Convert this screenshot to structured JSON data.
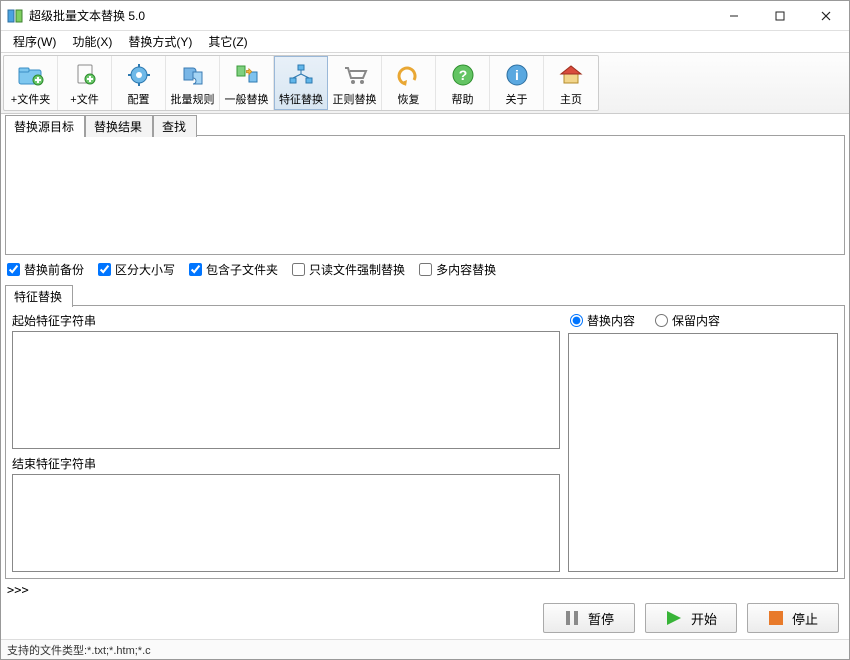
{
  "window": {
    "title": "超级批量文本替换 5.0"
  },
  "menubar": {
    "items": [
      {
        "label": "程序(W)"
      },
      {
        "label": "功能(X)"
      },
      {
        "label": "替换方式(Y)"
      },
      {
        "label": "其它(Z)"
      }
    ]
  },
  "toolbar": {
    "items": [
      {
        "name": "add-folder",
        "label": "+文件夹"
      },
      {
        "name": "add-file",
        "label": "+文件"
      },
      {
        "name": "config",
        "label": "配置"
      },
      {
        "name": "batch-rule",
        "label": "批量规则"
      },
      {
        "name": "normal-replace",
        "label": "一般替换"
      },
      {
        "name": "feature-replace",
        "label": "特征替换"
      },
      {
        "name": "regex-replace",
        "label": "正则替换"
      },
      {
        "name": "undo",
        "label": "恢复"
      },
      {
        "name": "help",
        "label": "帮助"
      },
      {
        "name": "about",
        "label": "关于"
      },
      {
        "name": "home",
        "label": "主页"
      }
    ]
  },
  "upper_tabs": {
    "items": [
      {
        "label": "替换源目标"
      },
      {
        "label": "替换结果"
      },
      {
        "label": "查找"
      }
    ],
    "active_index": 0
  },
  "options": {
    "backup": {
      "label": "替换前备份",
      "checked": true
    },
    "case_sensitive": {
      "label": "区分大小写",
      "checked": true
    },
    "subfolders": {
      "label": "包含子文件夹",
      "checked": true
    },
    "force_readonly": {
      "label": "只读文件强制替换",
      "checked": false
    },
    "multi_content": {
      "label": "多内容替换",
      "checked": false
    }
  },
  "lower_tab": {
    "label": "特征替换"
  },
  "feature": {
    "start_label": "起始特征字符串",
    "end_label": "结束特征字符串",
    "start_value": "",
    "end_value": ""
  },
  "content": {
    "radio_replace": "替换内容",
    "radio_keep": "保留内容",
    "selected": "replace",
    "value": ""
  },
  "prompt": ">>>",
  "actions": {
    "pause": "暂停",
    "start": "开始",
    "stop": "停止"
  },
  "statusbar": {
    "text": "支持的文件类型:*.txt;*.htm;*.c"
  }
}
